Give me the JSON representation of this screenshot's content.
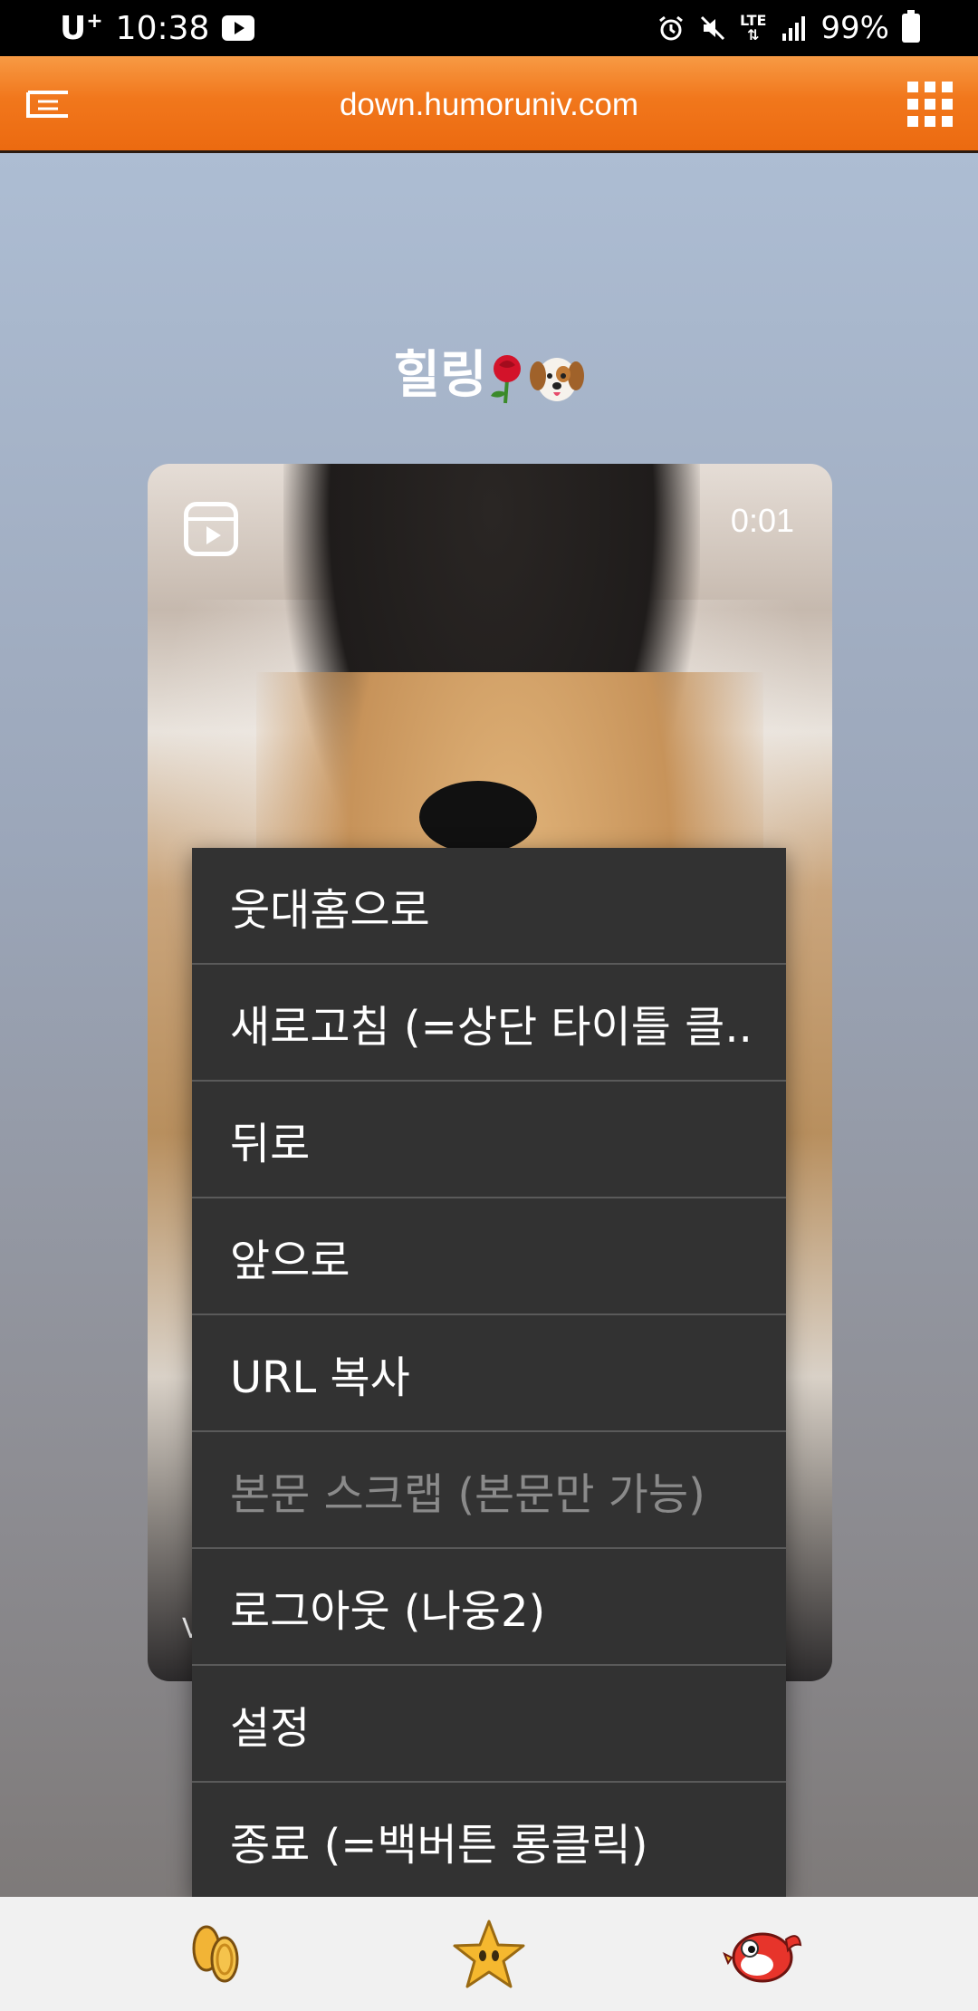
{
  "status_bar": {
    "carrier": "U",
    "carrier_sup": "+",
    "time": "10:38",
    "network": "LTE",
    "battery": "99%"
  },
  "header": {
    "url": "down.humoruniv.com"
  },
  "post": {
    "title": "힐링"
  },
  "video": {
    "duration": "0:01",
    "watermark": "V"
  },
  "context_menu": {
    "items": [
      {
        "label": "웃대홈으로",
        "enabled": true
      },
      {
        "label": "새로고침 (=상단 타이틀 클..",
        "enabled": true
      },
      {
        "label": "뒤로",
        "enabled": true
      },
      {
        "label": "앞으로",
        "enabled": true
      },
      {
        "label": "URL 복사",
        "enabled": true
      },
      {
        "label": "본문 스크랩 (본문만 가능)",
        "enabled": false
      },
      {
        "label": "로그아웃 (나웅2)",
        "enabled": true
      },
      {
        "label": "설정",
        "enabled": true
      },
      {
        "label": "종료 (=백버튼 롱클릭)",
        "enabled": true
      }
    ]
  },
  "bottom_nav": {
    "icons": [
      "coins-icon",
      "star-icon",
      "bird-mascot-icon"
    ]
  },
  "colors": {
    "header_orange": "#f1771c",
    "menu_bg": "#323232",
    "menu_disabled": "#8a8a8a"
  }
}
